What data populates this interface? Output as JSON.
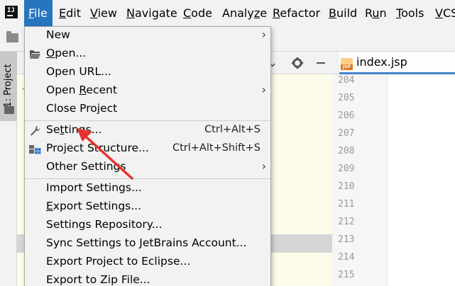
{
  "menubar": {
    "items": [
      {
        "label": "File",
        "mnemonic": "F",
        "rest": "ile"
      },
      {
        "label": "Edit",
        "mnemonic": "E",
        "rest": "dit"
      },
      {
        "label": "View",
        "mnemonic": "V",
        "rest": "iew"
      },
      {
        "label": "Navigate",
        "mnemonic": "N",
        "rest": "avigate"
      },
      {
        "label": "Code",
        "mnemonic": "C",
        "rest": "ode"
      },
      {
        "label": "Analyze",
        "pre": "Analy",
        "mnemonic": "z",
        "rest": "e"
      },
      {
        "label": "Refactor",
        "mnemonic": "R",
        "rest": "efactor"
      },
      {
        "label": "Build",
        "mnemonic": "B",
        "rest": "uild"
      },
      {
        "label": "Run",
        "mnemonic": "u",
        "pre": "R",
        "rest": "n"
      },
      {
        "label": "Tools",
        "mnemonic": "T",
        "rest": "ools"
      },
      {
        "label": "VCS",
        "mnemonic": "V",
        "rest": "CS"
      }
    ]
  },
  "side": {
    "project_label": "1: Project"
  },
  "editor": {
    "tab_label": "index.jsp",
    "tab_icon_text": "JSP",
    "line_numbers": [
      "204",
      "205",
      "206",
      "207",
      "208",
      "209",
      "210",
      "211",
      "212",
      "213",
      "214",
      "215"
    ]
  },
  "file_menu": {
    "new": "New",
    "open": {
      "mnemonic": "O",
      "rest": "pen..."
    },
    "open_url": "Open URL...",
    "open_recent": {
      "pre": "Open ",
      "mnemonic": "R",
      "rest": "ecent"
    },
    "close_project": "Close Project",
    "settings": {
      "pre": "Se",
      "mnemonic": "t",
      "rest": "tings...",
      "shortcut": "Ctrl+Alt+S"
    },
    "project_structure": {
      "label": "Project Structure...",
      "shortcut": "Ctrl+Alt+Shift+S"
    },
    "other_settings": "Other Settings",
    "import_settings": "Import Settings...",
    "export_settings": {
      "mnemonic": "E",
      "rest": "xport Settings..."
    },
    "settings_repository": "Settings Repository...",
    "sync_settings": "Sync Settings to JetBrains Account...",
    "export_eclipse": "Export Project to Eclipse...",
    "export_zip": "Export to Zip File..."
  },
  "colors": {
    "active_menu": "#2675bf",
    "annotation_arrow": "#e8332c"
  },
  "icons": {
    "settings": "wrench-icon",
    "open": "folder-open-icon",
    "project_structure": "project-structure-icon",
    "submenu": "chevron-right-icon"
  }
}
